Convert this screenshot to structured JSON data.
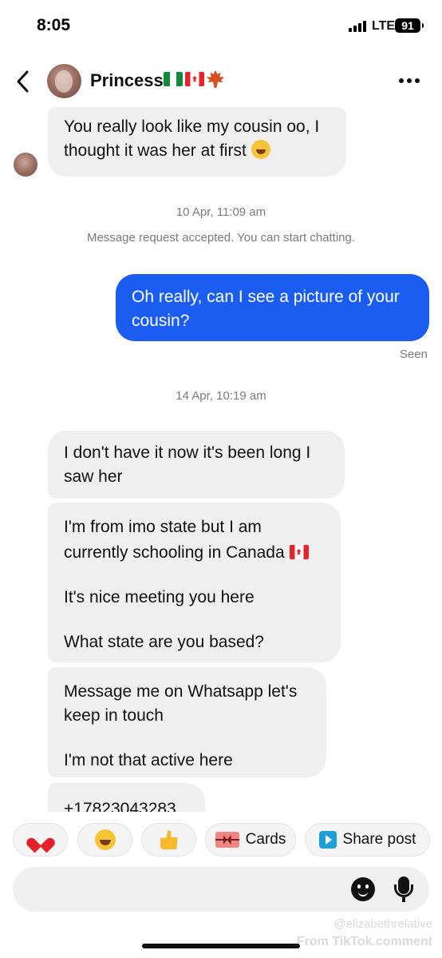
{
  "status_bar": {
    "time": "8:05",
    "network": "LTE",
    "battery": "91"
  },
  "header": {
    "contact_name": "Princess",
    "back_label": "back",
    "more_label": "more options"
  },
  "messages": {
    "m1": {
      "line1": "You really look like my cousin oo, I",
      "line2": "thought it was her at first"
    },
    "ts1": "10 Apr, 11:09 am",
    "system": "Message request accepted. You can start chatting.",
    "m2": {
      "line1": "Oh really, can I see a picture of your",
      "line2": "cousin?"
    },
    "seen": "Seen",
    "ts2": "14 Apr, 10:19 am",
    "m3": {
      "line1": "I don't have it now it's been long I",
      "line2": "saw her"
    },
    "m4": {
      "line1": "I'm from imo state but I am",
      "line2": "currently schooling in Canada",
      "line3": "It's nice meeting you here",
      "line4": "What state are you based?"
    },
    "m5": {
      "line1": "Message me on Whatsapp let's",
      "line2": "keep in touch",
      "line3": "I'm not that active here"
    },
    "m6": "+17823043283"
  },
  "quick_replies": {
    "cards": "Cards",
    "share_post": "Share post"
  },
  "composer": {
    "placeholder": ""
  },
  "watermark": {
    "user": "@elizabethrelative",
    "brand": "From TikTok.comment"
  },
  "colors": {
    "outgoing_bubble": "#1a5df0",
    "incoming_bubble": "#efefef"
  }
}
